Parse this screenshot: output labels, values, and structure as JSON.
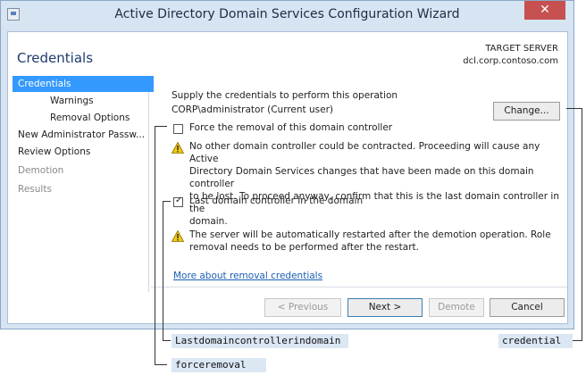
{
  "window": {
    "title": "Active Directory Domain Services Configuration Wizard",
    "close_glyph": "✕"
  },
  "header": {
    "page_title": "Credentials",
    "target_label": "TARGET SERVER",
    "target_value": "dcl.corp.contoso.com"
  },
  "nav": {
    "items": [
      {
        "label": "Credentials"
      },
      {
        "label": "Warnings"
      },
      {
        "label": "Removal Options"
      },
      {
        "label": "New Administrator Passw..."
      },
      {
        "label": "Review Options"
      },
      {
        "label": "Demotion"
      },
      {
        "label": "Results"
      }
    ]
  },
  "main": {
    "supply_text": "Supply the credentials to perform this operation",
    "current_user": "CORP\\administrator (Current user)",
    "change_button": "Change...",
    "force_removal_label": "Force the removal of this domain controller",
    "warning1_lines": [
      "No other domain controller could be contracted. Proceeding will cause any Active",
      "Directory Domain Services changes that have been made on this domain controller",
      "to be lost. To proceed anyway, confirm that this is the last domain controller in the",
      "domain."
    ],
    "last_dc_label": "Last domain controller in the domain",
    "warning2_lines": [
      "The server will be automatically restarted after the demotion operation. Role",
      "removal needs to be performed after the restart."
    ],
    "more_link": "More about removal credentials"
  },
  "footer": {
    "previous": "< Previous",
    "next": "Next >",
    "demote": "Demote",
    "cancel": "Cancel"
  },
  "callouts": {
    "last_dc": "Lastdomaincontrollerindomain",
    "force_removal": "forceremoval",
    "credential": "credential"
  },
  "colors": {
    "accent": "#3399ff",
    "close": "#c75050",
    "link": "#1a5fb4",
    "warning": "#f2c811"
  }
}
